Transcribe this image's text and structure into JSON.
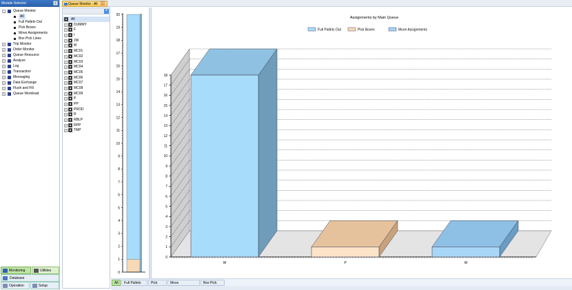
{
  "module_selector": {
    "title": "Module Selector",
    "pin_label": "x",
    "tree": [
      {
        "label": "Queue Monitor",
        "level": 0,
        "expander": "-",
        "icon": "square"
      },
      {
        "label": "All",
        "level": 1,
        "icon": "bullet",
        "selected": true
      },
      {
        "label": "Full Pallets Out",
        "level": 1,
        "icon": "bullet"
      },
      {
        "label": "Pick Boxes",
        "level": 1,
        "icon": "bullet"
      },
      {
        "label": "Move Assignments",
        "level": 1,
        "icon": "bullet"
      },
      {
        "label": "Box Pick Lines",
        "level": 1,
        "icon": "bullet"
      },
      {
        "label": "Trip Monitor",
        "level": 0,
        "expander": "+",
        "icon": "square"
      },
      {
        "label": "Order Monitor",
        "level": 0,
        "expander": "+",
        "icon": "square"
      },
      {
        "label": "Queue Resource",
        "level": 0,
        "expander": "+",
        "icon": "square"
      },
      {
        "label": "Analyze",
        "level": 0,
        "expander": "+",
        "icon": "square"
      },
      {
        "label": "Log",
        "level": 0,
        "expander": "+",
        "icon": "square"
      },
      {
        "label": "Transaction",
        "level": 0,
        "expander": "+",
        "icon": "square"
      },
      {
        "label": "Messaging",
        "level": 0,
        "expander": "+",
        "icon": "square"
      },
      {
        "label": "Data Exchange",
        "level": 0,
        "expander": "+",
        "icon": "square"
      },
      {
        "label": "Flush and Fill",
        "level": 0,
        "expander": "+",
        "icon": "square"
      },
      {
        "label": "Queue Workload",
        "level": 0,
        "expander": "+",
        "icon": "square"
      }
    ],
    "nav_buttons": {
      "monitoring": "Monitoring",
      "utilities": "Utilities",
      "database": "Database",
      "operation": "Operation",
      "setup": "Setup"
    }
  },
  "tabs": {
    "active_tab": "Queue Monitor : All",
    "close_label": "x"
  },
  "queue_list": {
    "add_label": "+",
    "items": [
      "All",
      "DUMMY",
      "F",
      "I",
      "JW",
      "M",
      "MC01",
      "MC02",
      "MC03",
      "MC04",
      "MC05",
      "MC06",
      "MC07",
      "MC08",
      "MC09",
      "P",
      "PP",
      "PROD",
      "R",
      "RBLP",
      "RPP",
      "TMP"
    ]
  },
  "bottom_tabs": [
    "All",
    "Full Pallets Out",
    "Pick Boxes",
    "Move Assignments",
    "Box Pick Lines"
  ],
  "colors": {
    "full_pallets": "#a7dcfb",
    "pick_boxes": "#f7d9b6",
    "move_assignments": "#a3d1f2",
    "accent": "#3c78c8",
    "active_tab": "#ffc94c"
  },
  "chart_data": [
    {
      "type": "bar",
      "categories": [
        ""
      ],
      "series": [
        {
          "name": "Full Pallets Out",
          "values": [
            20
          ]
        },
        {
          "name": "Pick Boxes",
          "values": [
            1
          ]
        }
      ],
      "ylim": [
        0,
        20
      ],
      "yticks": [
        0,
        1,
        2,
        3,
        4,
        5,
        6,
        7,
        8,
        9,
        10,
        11,
        12,
        13,
        14,
        15,
        16,
        17,
        18,
        19,
        20
      ],
      "stacked": true
    },
    {
      "type": "bar",
      "title": "Assignments by Main Queue",
      "categories": [
        "W",
        "P",
        "W"
      ],
      "series": [
        {
          "name": "Full Pallets Out",
          "values": [
            18,
            0,
            0
          ]
        },
        {
          "name": "Pick Boxes",
          "values": [
            0,
            1,
            0
          ]
        },
        {
          "name": "Move Assignments",
          "values": [
            0,
            0,
            1
          ]
        }
      ],
      "ylim": [
        0,
        18
      ],
      "yticks": [
        0,
        1,
        2,
        3,
        4,
        5,
        6,
        7,
        8,
        9,
        10,
        11,
        12,
        13,
        14,
        15,
        16,
        17,
        18
      ],
      "grid": true,
      "legend_position": "top-center",
      "three_d": true
    }
  ]
}
